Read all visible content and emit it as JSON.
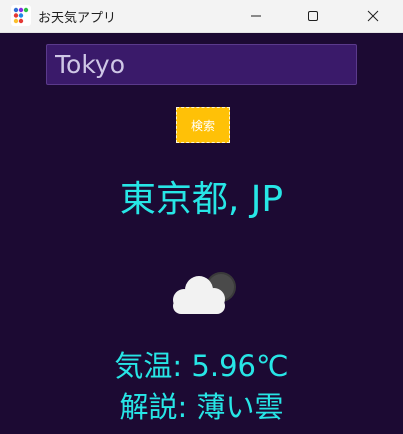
{
  "window": {
    "title": "お天気アプリ"
  },
  "search": {
    "value": "Tokyo",
    "button_label": "検索"
  },
  "result": {
    "location": "東京都, JP",
    "temperature": "気温: 5.96℃",
    "description": "解説: 薄い雲",
    "icon": "few-clouds-night-icon"
  },
  "colors": {
    "background": "#1c0a33",
    "accent_text": "#27e6e6",
    "button": "#ffc107",
    "input_bg": "#3a1a6a"
  }
}
